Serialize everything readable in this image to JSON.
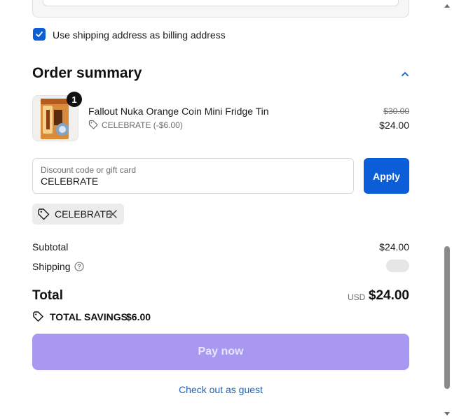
{
  "billing": {
    "use_shipping_label": "Use shipping address as billing address",
    "checked": true
  },
  "summary": {
    "title": "Order summary",
    "item": {
      "quantity": "1",
      "name": "Fallout Nuka Orange Coin Mini Fridge Tin",
      "discount_line": "CELEBRATE (-$6.00)",
      "original_price": "$30.00",
      "price": "$24.00"
    },
    "discount": {
      "placeholder": "Discount code or gift card",
      "value": "CELEBRATE",
      "apply_label": "Apply",
      "applied_code": "CELEBRATE"
    },
    "totals": {
      "subtotal_label": "Subtotal",
      "subtotal_value": "$24.00",
      "shipping_label": "Shipping",
      "total_label": "Total",
      "currency": "USD",
      "total_value": "$24.00",
      "savings_label": "TOTAL SAVINGS",
      "savings_value": "$6.00"
    },
    "pay_label": "Pay now",
    "guest_label": "Check out as guest"
  },
  "colors": {
    "accent": "#0b5ed7",
    "pay_button": "#a898f2",
    "link": "#1b63b5"
  },
  "icons": {
    "checkbox": "check-icon",
    "collapse": "chevron-up-icon",
    "discount": "tag-icon",
    "remove": "close-icon",
    "help": "question-circle-icon",
    "savings": "tag-icon"
  }
}
